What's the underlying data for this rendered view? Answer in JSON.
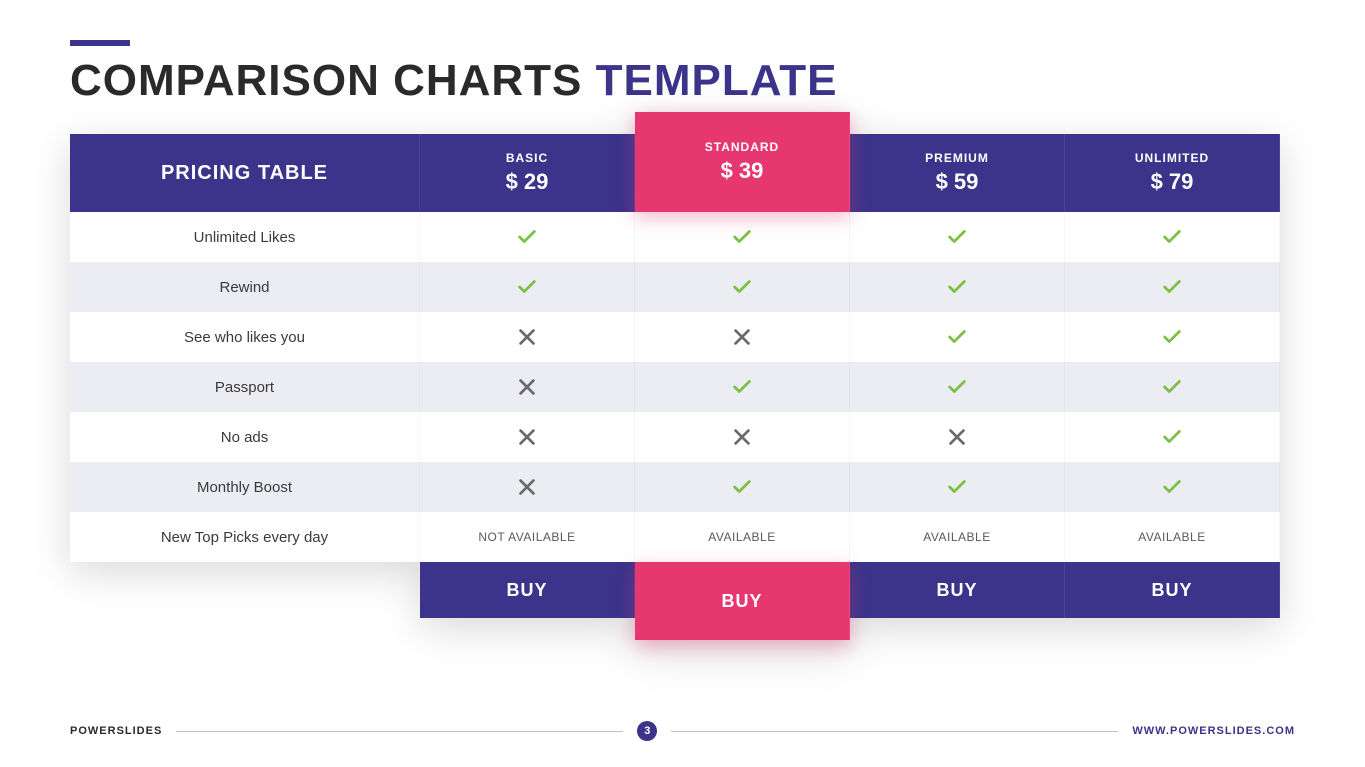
{
  "title": {
    "main": "COMPARISON CHARTS",
    "accent": "TEMPLATE"
  },
  "table_header": "PRICING TABLE",
  "plans": [
    {
      "name": "BASIC",
      "price": "$ 29",
      "highlight": false
    },
    {
      "name": "STANDARD",
      "price": "$ 39",
      "highlight": true
    },
    {
      "name": "PREMIUM",
      "price": "$ 59",
      "highlight": false
    },
    {
      "name": "UNLIMITED",
      "price": "$ 79",
      "highlight": false
    }
  ],
  "features": [
    "Unlimited Likes",
    "Rewind",
    "See who likes you",
    "Passport",
    "No ads",
    "Monthly Boost",
    "New Top Picks every day"
  ],
  "matrix": [
    [
      "check",
      "check",
      "check",
      "check"
    ],
    [
      "check",
      "check",
      "check",
      "check"
    ],
    [
      "cross",
      "cross",
      "check",
      "check"
    ],
    [
      "cross",
      "check",
      "check",
      "check"
    ],
    [
      "cross",
      "cross",
      "cross",
      "check"
    ],
    [
      "cross",
      "check",
      "check",
      "check"
    ],
    [
      "NOT AVAILABLE",
      "AVAILABLE",
      "AVAILABLE",
      "AVAILABLE"
    ]
  ],
  "buy_label": "BUY",
  "footer": {
    "brand_a": "POWER",
    "brand_b": "SLIDES",
    "page": "3",
    "url": "WWW.POWERSLIDES.COM"
  }
}
